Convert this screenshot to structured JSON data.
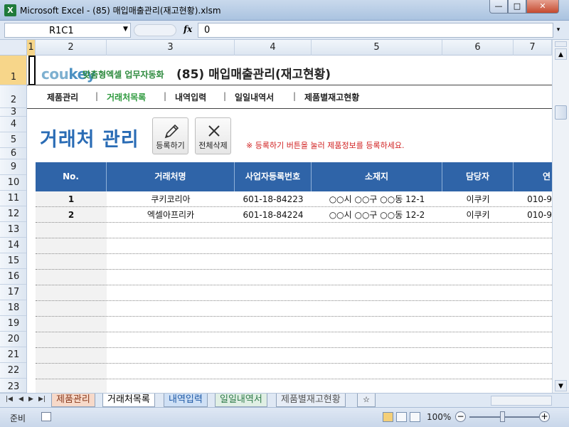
{
  "window": {
    "title": "Microsoft Excel - (85) 매입매출관리(재고현황).xlsm",
    "app_icon": "X",
    "minimize_glyph": "—",
    "maximize_glyph": "□",
    "close_glyph": "✕"
  },
  "formula_bar": {
    "name_box": "R1C1",
    "fx_label": "fx",
    "formula": "0"
  },
  "columns": [
    "1",
    "2",
    "3",
    "4",
    "5",
    "6",
    "7"
  ],
  "rows": [
    "1",
    "2",
    "3",
    "4",
    "5",
    "6",
    "9",
    "10",
    "11",
    "12",
    "13",
    "14",
    "15",
    "16",
    "17",
    "18",
    "19",
    "20",
    "21",
    "22",
    "23"
  ],
  "header": {
    "logo_co": "cou",
    "logo_key": "key",
    "slogan": "맞춤형엑셀 업무자동화",
    "title": "(85) 매입매출관리(재고현황)"
  },
  "nav": {
    "items": [
      "제품관리",
      "거래처목록",
      "내역입력",
      "일일내역서",
      "제품별재고현황"
    ],
    "separator": "|"
  },
  "section": {
    "title": "거래처 관리",
    "register_label": "등록하기",
    "delete_all_label": "전체삭제",
    "notice": "※ 등록하기 버튼을 눌러 제품정보를 등록하세요."
  },
  "table": {
    "headers": [
      "No.",
      "거래처명",
      "사업자등록번호",
      "소재지",
      "담당자",
      "연"
    ],
    "rows": [
      [
        "1",
        "쿠키코리아",
        "601-18-84223",
        "○○시 ○○구 ○○동 12-1",
        "이쿠키",
        "010-9"
      ],
      [
        "2",
        "엑셀아프리카",
        "601-18-84224",
        "○○시 ○○구 ○○동 12-2",
        "이쿠키",
        "010-9"
      ]
    ]
  },
  "sheet_tabs": [
    "제품관리",
    "거래처목록",
    "내역입력",
    "일일내역서",
    "제품별재고현황"
  ],
  "status": {
    "mode": "준비",
    "zoom": "100%"
  }
}
